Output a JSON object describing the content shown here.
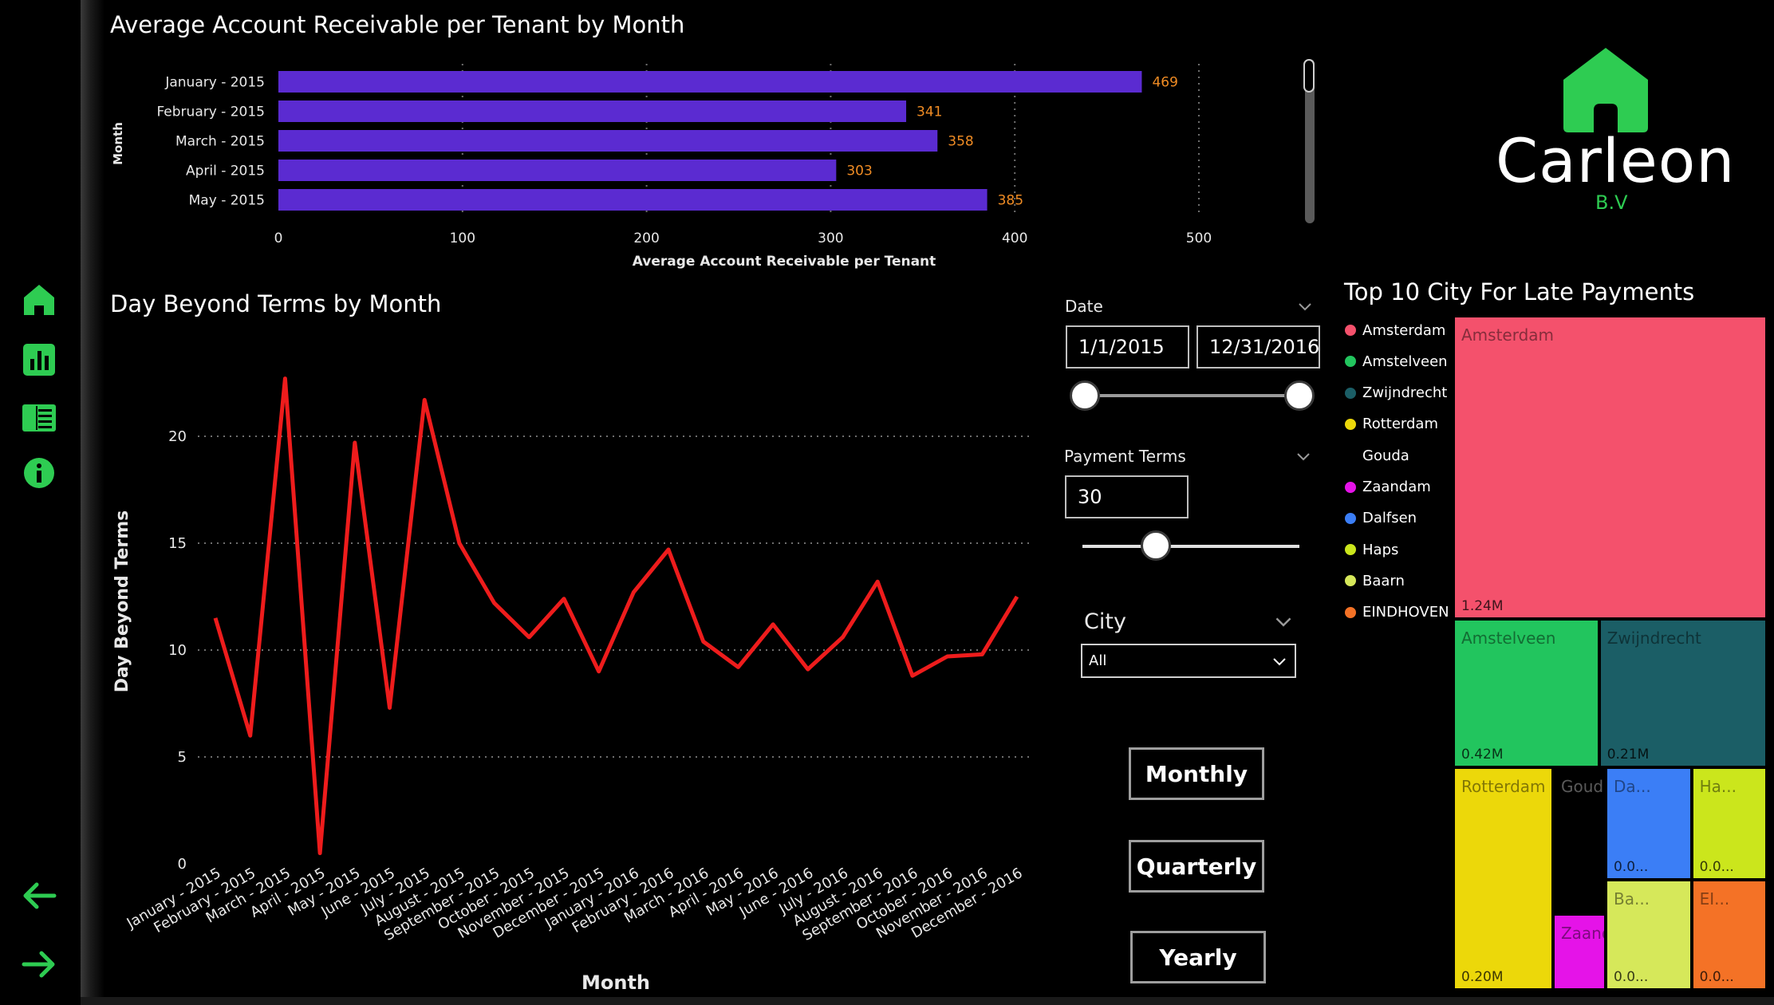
{
  "nav": {
    "icons": [
      "home-icon",
      "bar-chart-icon",
      "details-icon",
      "info-icon"
    ],
    "back_icon": "arrow-left-icon",
    "forward_icon": "arrow-right-icon",
    "accent": "#2ecc52"
  },
  "logo": {
    "name": "Carleon",
    "suffix": "B.V"
  },
  "bar_title": "Average Account Receivable per Tenant by Month",
  "line_title": "Day Beyond Terms by Month",
  "treemap_title": "Top 10 City For Late Payments",
  "slicers": {
    "date": {
      "label": "Date",
      "start": "1/1/2015",
      "end": "12/31/2016"
    },
    "payment_terms": {
      "label": "Payment Terms",
      "value": "30",
      "fraction": 0.34
    },
    "city": {
      "label": "City",
      "selected": "All"
    }
  },
  "buttons": {
    "monthly": "Monthly",
    "quarterly": "Quarterly",
    "yearly": "Yearly"
  },
  "chart_data": [
    {
      "type": "bar",
      "orientation": "horizontal",
      "title": "Average Account Receivable per Tenant by Month",
      "xlabel": "Average Account Receivable per Tenant",
      "ylabel": "Month",
      "categories": [
        "January - 2015",
        "February - 2015",
        "March - 2015",
        "April - 2015",
        "May - 2015"
      ],
      "values": [
        469,
        341,
        358,
        303,
        385
      ],
      "xlim": [
        0,
        500
      ],
      "xticks": [
        0,
        100,
        200,
        300,
        400,
        500
      ],
      "bar_color": "#5b2bd1",
      "label_color": "#f08c24",
      "grid": true
    },
    {
      "type": "line",
      "title": "Day Beyond Terms by Month",
      "xlabel": "Month",
      "ylabel": "Day Beyond Terms",
      "categories": [
        "January - 2015",
        "February - 2015",
        "March - 2015",
        "April - 2015",
        "May - 2015",
        "June - 2015",
        "July - 2015",
        "August - 2015",
        "September - 2015",
        "October - 2015",
        "November - 2015",
        "December - 2015",
        "January - 2016",
        "February - 2016",
        "March - 2016",
        "April - 2016",
        "May - 2016",
        "June - 2016",
        "July - 2016",
        "August - 2016",
        "September - 2016",
        "October - 2016",
        "November - 2016",
        "December - 2016"
      ],
      "values": [
        11.5,
        6.0,
        22.7,
        0.5,
        19.7,
        7.3,
        21.7,
        15.0,
        12.2,
        10.6,
        12.4,
        9.0,
        12.7,
        14.7,
        10.4,
        9.2,
        11.2,
        9.1,
        10.6,
        13.2,
        8.8,
        9.7,
        9.8,
        12.5
      ],
      "ylim": [
        0,
        23
      ],
      "yticks": [
        0,
        5,
        10,
        15,
        20
      ],
      "line_color": "#ee1c1c",
      "grid": true
    },
    {
      "type": "treemap",
      "title": "Top 10 City For Late Payments",
      "items": [
        {
          "name": "Amsterdam",
          "value": 1.24,
          "label": "1.24M",
          "color": "#f4516c"
        },
        {
          "name": "Amstelveen",
          "value": 0.42,
          "label": "0.42M",
          "color": "#22c55e"
        },
        {
          "name": "Zwijndrecht",
          "value": 0.21,
          "label": "0.21M",
          "color": "#1b5e66"
        },
        {
          "name": "Rotterdam",
          "value": 0.2,
          "label": "0.20M",
          "color": "#ecd80a"
        },
        {
          "name": "Gouda",
          "value": 0.09,
          "label": "",
          "color": "#000000"
        },
        {
          "name": "Zaandam",
          "value": 0.04,
          "label": "",
          "color": "#e513e8"
        },
        {
          "name": "Dalfsen",
          "value": 0.05,
          "label": "0.0...",
          "color": "#3b7ef6"
        },
        {
          "name": "Haps",
          "value": 0.05,
          "label": "0.0...",
          "color": "#cbe61c"
        },
        {
          "name": "Baarn",
          "value": 0.05,
          "label": "0.0...",
          "color": "#d6e85a"
        },
        {
          "name": "EINDHOVEN",
          "value": 0.05,
          "label": "0.0...",
          "color": "#f47226"
        }
      ],
      "display": {
        "Amsterdam": "Amsterdam",
        "Amstelveen": "Amstelveen",
        "Zwijndrecht": "Zwijndrecht",
        "Rotterdam": "Rotterdam",
        "Gouda": "Gouda",
        "Zaandam": "Zaand...",
        "Dalfsen": "Da...",
        "Haps": "Ha...",
        "Baarn": "Ba...",
        "EINDHOVEN": "EI..."
      },
      "legend": [
        {
          "name": "Amsterdam",
          "color": "#f4516c"
        },
        {
          "name": "Amstelveen",
          "color": "#22c55e"
        },
        {
          "name": "Zwijndrecht",
          "color": "#1b5e66"
        },
        {
          "name": "Rotterdam",
          "color": "#ecd80a"
        },
        {
          "name": "Gouda",
          "color": "#000000"
        },
        {
          "name": "Zaandam",
          "color": "#e513e8"
        },
        {
          "name": "Dalfsen",
          "color": "#3b7ef6"
        },
        {
          "name": "Haps",
          "color": "#cbe61c"
        },
        {
          "name": "Baarn",
          "color": "#d6e85a"
        },
        {
          "name": "EINDHOVEN",
          "color": "#f47226"
        }
      ]
    }
  ]
}
